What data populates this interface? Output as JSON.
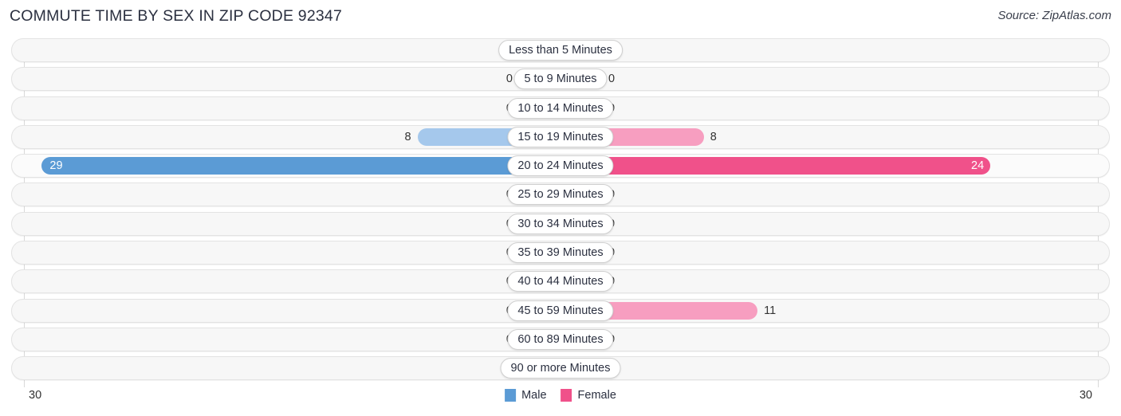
{
  "header": {
    "title": "COMMUTE TIME BY SEX IN ZIP CODE 92347",
    "source": "Source: ZipAtlas.com"
  },
  "legend": {
    "male_label": "Male",
    "female_label": "Female",
    "male_color": "#5b9bd5",
    "female_color": "#f0518a"
  },
  "axis": {
    "left_label": "30",
    "right_label": "30"
  },
  "chart_data": {
    "type": "bar",
    "title": "COMMUTE TIME BY SEX IN ZIP CODE 92347",
    "subtitle": "Source: ZipAtlas.com",
    "orientation": "horizontal-diverging",
    "xlabel": "",
    "ylabel": "",
    "xlim": [
      30,
      30
    ],
    "grid": true,
    "legend_position": "bottom-center",
    "categories": [
      "Less than 5 Minutes",
      "5 to 9 Minutes",
      "10 to 14 Minutes",
      "15 to 19 Minutes",
      "20 to 24 Minutes",
      "25 to 29 Minutes",
      "30 to 34 Minutes",
      "35 to 39 Minutes",
      "40 to 44 Minutes",
      "45 to 59 Minutes",
      "60 to 89 Minutes",
      "90 or more Minutes"
    ],
    "series": [
      {
        "name": "Male",
        "color": "#5b9bd5",
        "values": [
          0,
          0,
          0,
          8,
          29,
          0,
          0,
          0,
          0,
          0,
          0,
          0
        ]
      },
      {
        "name": "Female",
        "color": "#f0518a",
        "values": [
          0,
          0,
          0,
          8,
          24,
          0,
          0,
          0,
          0,
          11,
          0,
          0
        ]
      }
    ],
    "highlighted_category": "20 to 24 Minutes"
  },
  "rows": [
    {
      "label": "Less than 5 Minutes",
      "male": "0",
      "female": "0",
      "highlight": false
    },
    {
      "label": "5 to 9 Minutes",
      "male": "0",
      "female": "0",
      "highlight": false
    },
    {
      "label": "10 to 14 Minutes",
      "male": "0",
      "female": "0",
      "highlight": false
    },
    {
      "label": "15 to 19 Minutes",
      "male": "8",
      "female": "8",
      "highlight": false
    },
    {
      "label": "20 to 24 Minutes",
      "male": "29",
      "female": "24",
      "highlight": true
    },
    {
      "label": "25 to 29 Minutes",
      "male": "0",
      "female": "0",
      "highlight": false
    },
    {
      "label": "30 to 34 Minutes",
      "male": "0",
      "female": "0",
      "highlight": false
    },
    {
      "label": "35 to 39 Minutes",
      "male": "0",
      "female": "0",
      "highlight": false
    },
    {
      "label": "40 to 44 Minutes",
      "male": "0",
      "female": "0",
      "highlight": false
    },
    {
      "label": "45 to 59 Minutes",
      "male": "0",
      "female": "11",
      "highlight": false
    },
    {
      "label": "60 to 89 Minutes",
      "male": "0",
      "female": "0",
      "highlight": false
    },
    {
      "label": "90 or more Minutes",
      "male": "0",
      "female": "0",
      "highlight": false
    }
  ]
}
